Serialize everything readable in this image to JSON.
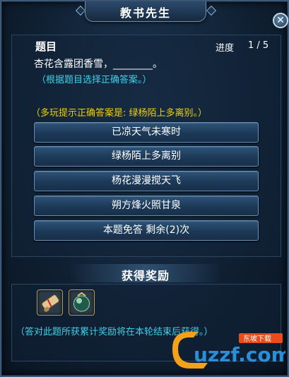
{
  "window": {
    "title": "教书先生"
  },
  "question": {
    "heading": "题目",
    "progress_label": "进度",
    "progress": "1 / 5",
    "prompt": "杏花含露团香雪，________。",
    "hint": "（根据题目选择正确答案。）"
  },
  "multiplayer_hint": "（多玩提示正确答案是: 绿杨陌上多离别。）",
  "answers": [
    {
      "label": "已凉天气未寒时"
    },
    {
      "label": "绿杨陌上多离别"
    },
    {
      "label": "杨花漫漫搅天飞"
    },
    {
      "label": "朔方烽火照甘泉"
    }
  ],
  "skip_button": {
    "label": "本题免答 剩余(2)次"
  },
  "rewards": {
    "title": "获得奖励",
    "items": [
      {
        "icon": "scroll-icon"
      },
      {
        "icon": "orb-icon"
      }
    ],
    "note": "（答对此题所获累计奖励将在本轮结束后获得。）"
  },
  "watermark": {
    "site": "uzzf.com",
    "tagline": "东坡下载"
  },
  "colors": {
    "accent_text": "#3fd0e8",
    "hint_text": "#f0d000",
    "button_bg": "#1c3957",
    "frame_border": "#3e5a78"
  }
}
